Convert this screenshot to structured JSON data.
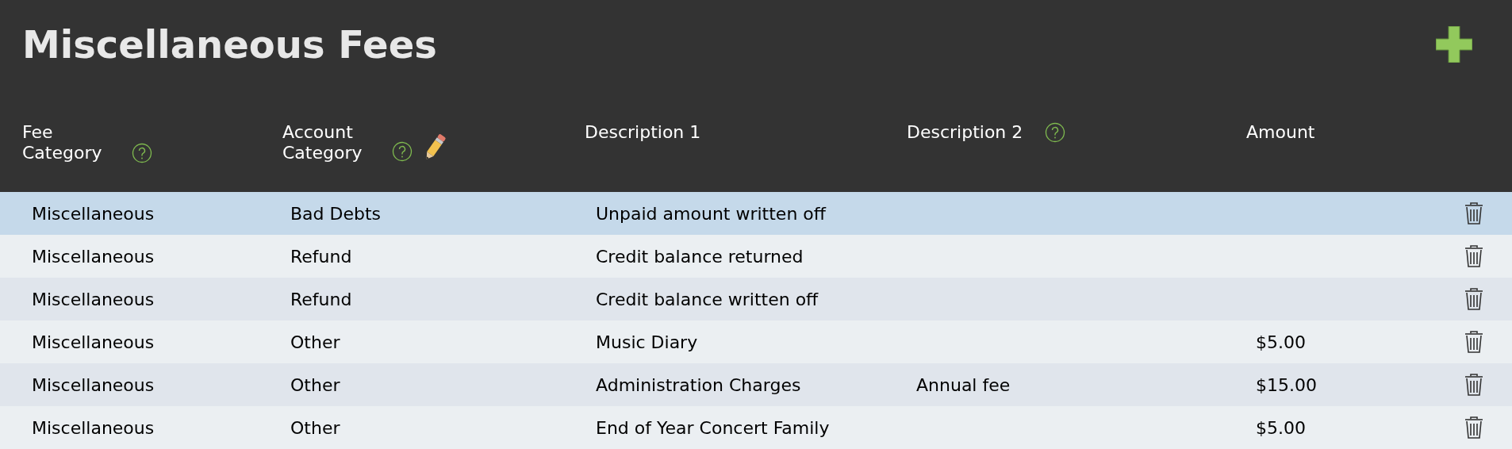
{
  "title": "Miscellaneous Fees",
  "columns": [
    {
      "label": "Fee Category",
      "help": true,
      "edit": false
    },
    {
      "label": "Account Category",
      "help": true,
      "edit": true
    },
    {
      "label": "Description 1",
      "help": false,
      "edit": false
    },
    {
      "label": "Description 2",
      "help": true,
      "edit": false
    },
    {
      "label": "Amount",
      "help": false,
      "edit": false
    }
  ],
  "rows": [
    {
      "selected": true,
      "cells": [
        "Miscellaneous",
        "Bad Debts",
        "Unpaid amount written off",
        "",
        ""
      ]
    },
    {
      "selected": false,
      "cells": [
        "Miscellaneous",
        "Refund",
        "Credit balance returned",
        "",
        ""
      ]
    },
    {
      "selected": false,
      "cells": [
        "Miscellaneous",
        "Refund",
        "Credit balance written off",
        "",
        ""
      ]
    },
    {
      "selected": false,
      "cells": [
        "Miscellaneous",
        "Other",
        "Music Diary",
        "",
        "$5.00"
      ]
    },
    {
      "selected": false,
      "cells": [
        "Miscellaneous",
        "Other",
        "Administration Charges",
        "Annual fee",
        "$15.00"
      ]
    },
    {
      "selected": false,
      "cells": [
        "Miscellaneous",
        "Other",
        "End of Year Concert Family",
        "",
        "$5.00"
      ]
    }
  ]
}
